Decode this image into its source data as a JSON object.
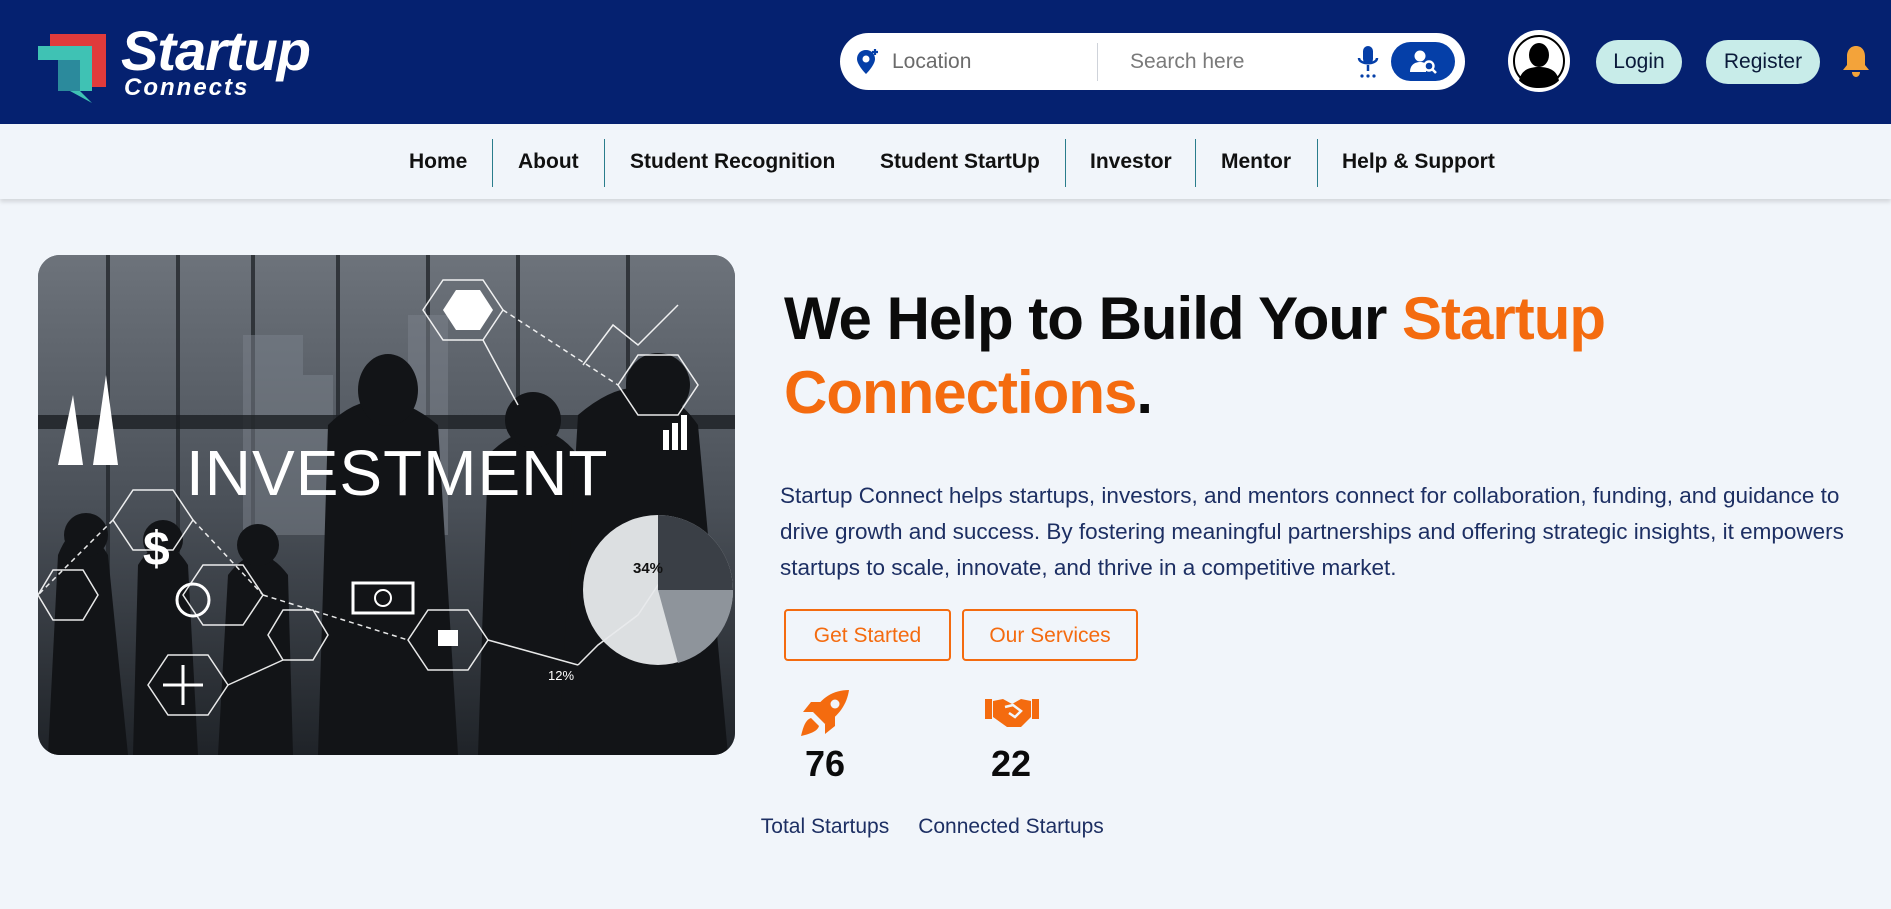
{
  "brand": {
    "name_line1": "Startup",
    "name_line2": "Connects",
    "colors": {
      "primary": "#052170",
      "accent": "#f46b0f",
      "teal": "#3fc2b4",
      "red": "#e03b3b",
      "pill": "#c8ece9"
    }
  },
  "header": {
    "location_placeholder": "Location",
    "search_placeholder": "Search here",
    "login_label": "Login",
    "register_label": "Register",
    "icons": [
      "location-pin-icon",
      "microphone-icon",
      "user-search-icon",
      "avatar",
      "bell-icon"
    ]
  },
  "nav": {
    "items": [
      {
        "label": "Home"
      },
      {
        "label": "About"
      },
      {
        "label": "Student Recognition"
      },
      {
        "label": "Student StartUp"
      },
      {
        "label": "Investor"
      },
      {
        "label": "Mentor"
      },
      {
        "label": "Help & Support"
      }
    ]
  },
  "hero": {
    "image_text": "INVESTMENT",
    "image_labels": {
      "percent_a": "34%",
      "percent_b": "12%"
    },
    "title_part1": "We Help to Build Your ",
    "title_highlight": "Startup Connections",
    "title_end": ".",
    "description": "Startup Connect helps startups, investors, and mentors connect for collaboration, funding, and guidance to drive growth and success. By fostering meaningful partnerships and offering strategic insights, it empowers startups to scale, innovate, and thrive in a competitive market.",
    "buttons": {
      "get_started": "Get Started",
      "our_services": "Our Services"
    }
  },
  "stats": [
    {
      "value": "76",
      "label": "Total Startups",
      "icon": "rocket-icon"
    },
    {
      "value": "22",
      "label": "Connected Startups",
      "icon": "handshake-icon"
    }
  ]
}
